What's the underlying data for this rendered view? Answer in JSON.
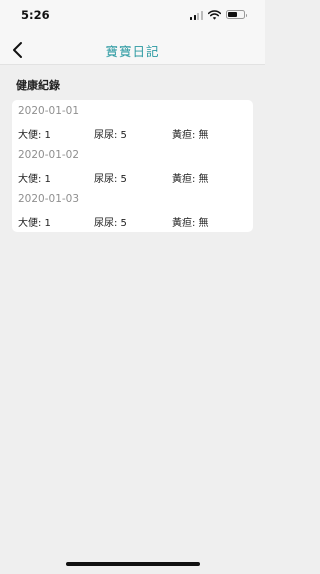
{
  "status_bar": {
    "time": "5:26",
    "signal_bars_active": 2,
    "signal_bars_total": 4,
    "battery_level": 0.6,
    "icons": [
      "cellular-signal-icon",
      "wifi-icon",
      "battery-icon"
    ]
  },
  "nav": {
    "back_icon": "chevron-left-icon",
    "title": "寶寶日記",
    "title_color": "#2c9aa2"
  },
  "section": {
    "title": "健康紀錄"
  },
  "records": [
    {
      "date": "2020-01-01",
      "stool": "大便: 1",
      "urine": "尿尿: 5",
      "jaundice": "黃疸: 無"
    },
    {
      "date": "2020-01-02",
      "stool": "大便: 1",
      "urine": "尿尿: 5",
      "jaundice": "黃疸: 無"
    },
    {
      "date": "2020-01-03",
      "stool": "大便: 1",
      "urine": "尿尿: 5",
      "jaundice": "黃疸: 無"
    }
  ]
}
